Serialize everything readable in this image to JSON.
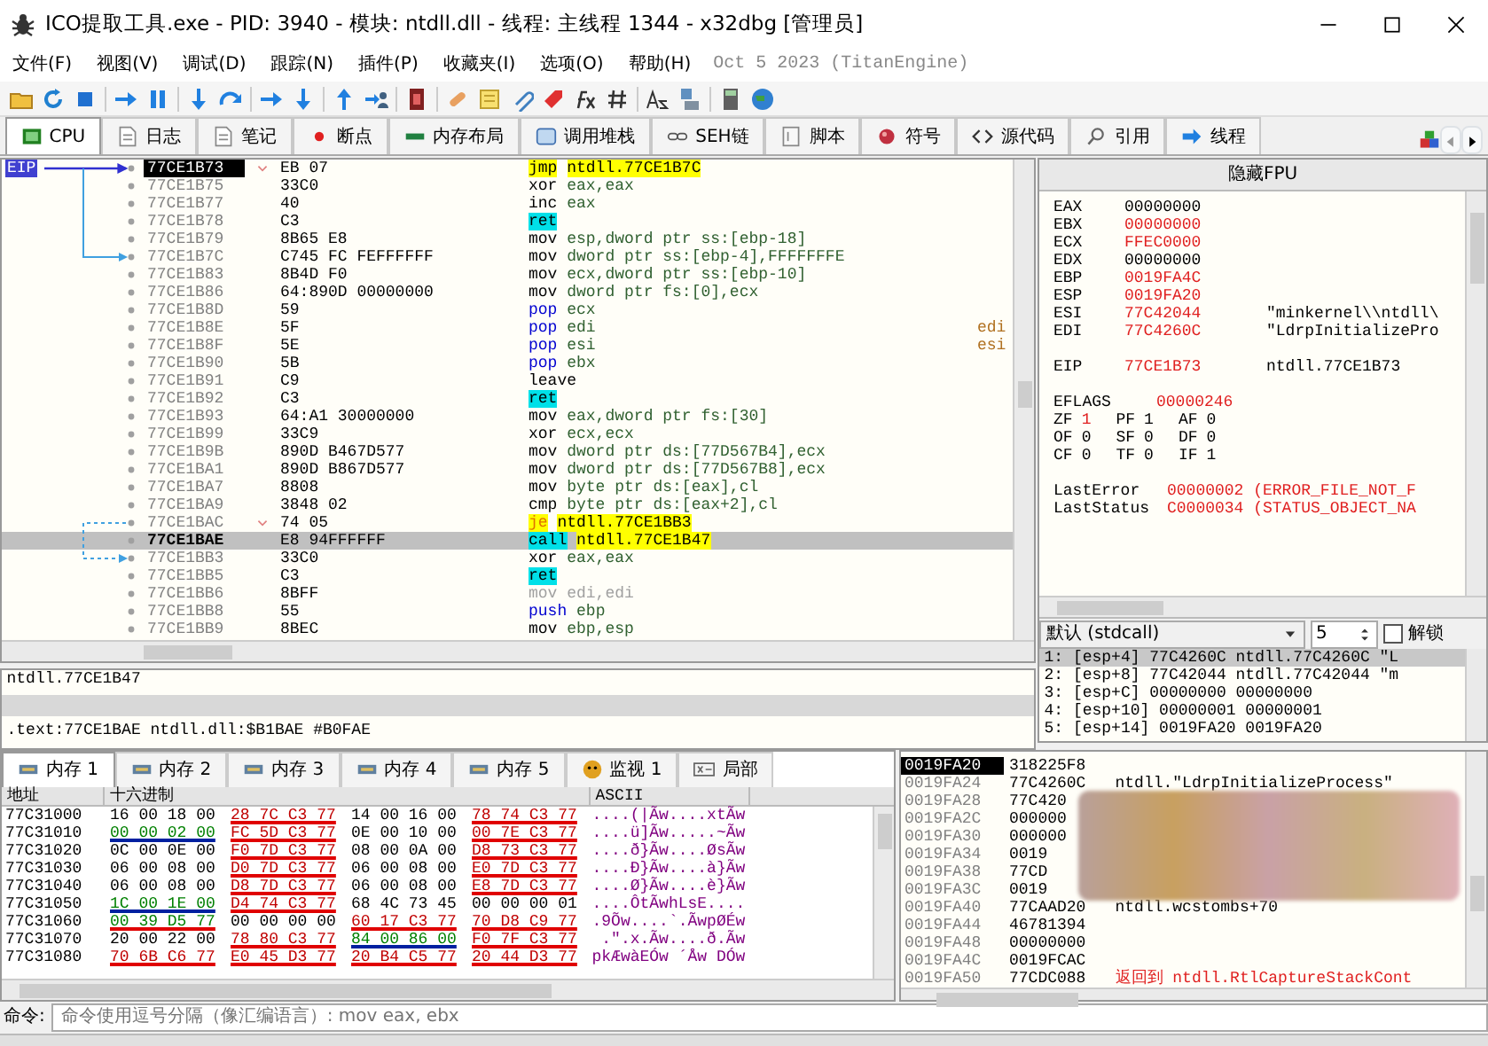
{
  "window": {
    "title": "ICO提取工具.exe - PID: 3940 - 模块: ntdll.dll - 线程: 主线程 1344 - x32dbg [管理员]"
  },
  "menu": [
    "文件(F)",
    "视图(V)",
    "调试(D)",
    "跟踪(N)",
    "插件(P)",
    "收藏夹(I)",
    "选项(O)",
    "帮助(H)"
  ],
  "build_info": "Oct 5 2023 (TitanEngine)",
  "tabs": [
    {
      "label": "CPU",
      "selected": true
    },
    {
      "label": "日志",
      "selected": false
    },
    {
      "label": "笔记",
      "selected": false
    },
    {
      "label": "断点",
      "selected": false
    },
    {
      "label": "内存布局",
      "selected": false
    },
    {
      "label": "调用堆栈",
      "selected": false
    },
    {
      "label": "SEH链",
      "selected": false
    },
    {
      "label": "脚本",
      "selected": false
    },
    {
      "label": "符号",
      "selected": false
    },
    {
      "label": "源代码",
      "selected": false
    },
    {
      "label": "引用",
      "selected": false
    },
    {
      "label": "线程",
      "selected": false
    }
  ],
  "disasm": {
    "eip_label": "EIP",
    "rows": [
      {
        "address": "77CE1B73",
        "bytes": "EB 07",
        "mnemonic": "jmp",
        "operands": "ntdll.77CE1B7C",
        "kind": "jump",
        "eip": true,
        "selected": false,
        "branch": true,
        "branch_taken": true
      },
      {
        "address": "77CE1B75",
        "bytes": "33C0",
        "mnemonic": "xor",
        "operands": "eax,eax",
        "kind": "plain",
        "eip": false,
        "selected": false
      },
      {
        "address": "77CE1B77",
        "bytes": "40",
        "mnemonic": "inc",
        "operands": "eax",
        "kind": "plain",
        "eip": false,
        "selected": false
      },
      {
        "address": "77CE1B78",
        "bytes": "C3",
        "mnemonic": "ret",
        "kind": "ret",
        "eip": false,
        "selected": false
      },
      {
        "address": "77CE1B79",
        "bytes": "8B65 E8",
        "mnemonic": "mov",
        "operands": "esp,dword ptr ss:[ebp-18]",
        "kind": "plain",
        "eip": false,
        "selected": false
      },
      {
        "address": "77CE1B7C",
        "bytes": "C745 FC FEFFFFFF",
        "mnemonic": "mov",
        "operands": "dword ptr ss:[ebp-4],FFFFFFFE",
        "kind": "plain",
        "eip": false,
        "selected": false,
        "arrow_target": true
      },
      {
        "address": "77CE1B83",
        "bytes": "8B4D F0",
        "mnemonic": "mov",
        "operands": "ecx,dword ptr ss:[ebp-10]",
        "kind": "plain",
        "eip": false,
        "selected": false
      },
      {
        "address": "77CE1B86",
        "bytes": "64:890D 00000000",
        "mnemonic": "mov",
        "operands": "dword ptr fs:[0],ecx",
        "kind": "plain",
        "eip": false,
        "selected": false
      },
      {
        "address": "77CE1B8D",
        "bytes": "59",
        "mnemonic": "pop",
        "operands": "ecx",
        "kind": "stack",
        "eip": false,
        "selected": false
      },
      {
        "address": "77CE1B8E",
        "bytes": "5F",
        "mnemonic": "pop",
        "operands": "edi",
        "kind": "stack",
        "eip": false,
        "selected": false,
        "comment": "edi"
      },
      {
        "address": "77CE1B8F",
        "bytes": "5E",
        "mnemonic": "pop",
        "operands": "esi",
        "kind": "stack",
        "eip": false,
        "selected": false,
        "comment": "esi"
      },
      {
        "address": "77CE1B90",
        "bytes": "5B",
        "mnemonic": "pop",
        "operands": "ebx",
        "kind": "stack",
        "eip": false,
        "selected": false
      },
      {
        "address": "77CE1B91",
        "bytes": "C9",
        "mnemonic": "leave",
        "kind": "plain",
        "eip": false,
        "selected": false
      },
      {
        "address": "77CE1B92",
        "bytes": "C3",
        "mnemonic": "ret",
        "kind": "ret",
        "eip": false,
        "selected": false
      },
      {
        "address": "77CE1B93",
        "bytes": "64:A1 30000000",
        "mnemonic": "mov",
        "operands": "eax,dword ptr fs:[30]",
        "kind": "plain",
        "eip": false,
        "selected": false
      },
      {
        "address": "77CE1B99",
        "bytes": "33C9",
        "mnemonic": "xor",
        "operands": "ecx,ecx",
        "kind": "plain",
        "eip": false,
        "selected": false
      },
      {
        "address": "77CE1B9B",
        "bytes": "890D B467D577",
        "mnemonic": "mov",
        "operands": "dword ptr ds:[77D567B4],ecx",
        "kind": "plain",
        "eip": false,
        "selected": false
      },
      {
        "address": "77CE1BA1",
        "bytes": "890D B867D577",
        "mnemonic": "mov",
        "operands": "dword ptr ds:[77D567B8],ecx",
        "kind": "plain",
        "eip": false,
        "selected": false
      },
      {
        "address": "77CE1BA7",
        "bytes": "8808",
        "mnemonic": "mov",
        "operands": "byte ptr ds:[eax],cl",
        "kind": "plain",
        "eip": false,
        "selected": false
      },
      {
        "address": "77CE1BA9",
        "bytes": "3848 02",
        "mnemonic": "cmp",
        "operands": "byte ptr ds:[eax+2],cl",
        "kind": "plain",
        "eip": false,
        "selected": false
      },
      {
        "address": "77CE1BAC",
        "bytes": "74 05",
        "mnemonic": "je",
        "operands": "ntdll.77CE1BB3",
        "kind": "cond-jump",
        "eip": false,
        "selected": false,
        "branch": true,
        "branch_taken": false
      },
      {
        "address": "77CE1BAE",
        "bytes": "E8 94FFFFFF",
        "mnemonic": "call",
        "operands": "ntdll.77CE1B47",
        "kind": "call",
        "eip": false,
        "selected": true
      },
      {
        "address": "77CE1BB3",
        "bytes": "33C0",
        "mnemonic": "xor",
        "operands": "eax,eax",
        "kind": "plain",
        "eip": false,
        "selected": false,
        "arrow_target": true
      },
      {
        "address": "77CE1BB5",
        "bytes": "C3",
        "mnemonic": "ret",
        "kind": "ret",
        "eip": false,
        "selected": false
      },
      {
        "address": "77CE1BB6",
        "bytes": "8BFF",
        "mnemonic": "mov",
        "operands": "edi,edi",
        "kind": "padding",
        "eip": false,
        "selected": false
      },
      {
        "address": "77CE1BB8",
        "bytes": "55",
        "mnemonic": "push",
        "operands": "ebp",
        "kind": "stack",
        "eip": false,
        "selected": false
      },
      {
        "address": "77CE1BB9",
        "bytes": "8BEC",
        "mnemonic": "mov",
        "operands": "ebp,esp",
        "kind": "plain",
        "eip": false,
        "selected": false
      }
    ]
  },
  "registers": {
    "header": "隐藏FPU",
    "general": [
      {
        "name": "EAX",
        "value": "00000000",
        "changed": false
      },
      {
        "name": "EBX",
        "value": "00000000",
        "changed": true
      },
      {
        "name": "ECX",
        "value": "FFEC0000",
        "changed": true
      },
      {
        "name": "EDX",
        "value": "00000000",
        "changed": false
      },
      {
        "name": "EBP",
        "value": "0019FA4C",
        "changed": true
      },
      {
        "name": "ESP",
        "value": "0019FA20",
        "changed": true
      },
      {
        "name": "ESI",
        "value": "77C42044",
        "changed": true,
        "comment": "\"minkernel\\\\ntdll\\"
      },
      {
        "name": "EDI",
        "value": "77C4260C",
        "changed": true,
        "comment": "\"LdrpInitializePro"
      }
    ],
    "eip": {
      "name": "EIP",
      "value": "77CE1B73",
      "changed": true,
      "comment": "ntdll.77CE1B73"
    },
    "eflags": {
      "name": "EFLAGS",
      "value": "00000246",
      "changed": true
    },
    "flags": [
      [
        {
          "name": "ZF",
          "value": "1",
          "changed": true
        },
        {
          "name": "PF",
          "value": "1",
          "changed": false
        },
        {
          "name": "AF",
          "value": "0",
          "changed": false
        }
      ],
      [
        {
          "name": "OF",
          "value": "0",
          "changed": false
        },
        {
          "name": "SF",
          "value": "0",
          "changed": false
        },
        {
          "name": "DF",
          "value": "0",
          "changed": false
        }
      ],
      [
        {
          "name": "CF",
          "value": "0",
          "changed": false
        },
        {
          "name": "TF",
          "value": "0",
          "changed": false
        },
        {
          "name": "IF",
          "value": "1",
          "changed": false
        }
      ]
    ],
    "errors": [
      {
        "name": "LastError",
        "value": "00000002 (ERROR_FILE_NOT_F"
      },
      {
        "name": "LastStatus",
        "value": "C0000034 (STATUS_OBJECT_NA"
      }
    ]
  },
  "call_convention": {
    "value": "默认 (stdcall)",
    "count": "5",
    "unlock_label": "解锁",
    "unlock_checked": false
  },
  "arguments": [
    {
      "text": "1: [esp+4] 77C4260C ntdll.77C4260C \"L",
      "selected": true
    },
    {
      "text": "2: [esp+8] 77C42044 ntdll.77C42044 \"m",
      "selected": false
    },
    {
      "text": "3: [esp+C] 00000000 00000000",
      "selected": false
    },
    {
      "text": "4: [esp+10] 00000001 00000001",
      "selected": false
    },
    {
      "text": "5: [esp+14] 0019FA20 0019FA20",
      "selected": false
    }
  ],
  "info": {
    "line_1": "ntdll.77CE1B47",
    "line_2": ".text:77CE1BAE ntdll.dll:$B1BAE #B0FAE"
  },
  "dump": {
    "tabs": [
      {
        "label": "内存 1",
        "kind": "memory",
        "selected": true
      },
      {
        "label": "内存 2",
        "kind": "memory",
        "selected": false
      },
      {
        "label": "内存 3",
        "kind": "memory",
        "selected": false
      },
      {
        "label": "内存 4",
        "kind": "memory",
        "selected": false
      },
      {
        "label": "内存 5",
        "kind": "memory",
        "selected": false
      },
      {
        "label": "监视 1",
        "kind": "watch",
        "selected": false
      },
      {
        "label": "局部",
        "kind": "locals",
        "selected": false
      }
    ],
    "columns": [
      "地址",
      "十六进制",
      "ASCII"
    ],
    "rows": [
      {
        "address": "77C31000",
        "groups": [
          {
            "hex": "16 00 18 00",
            "kind": "plain"
          },
          {
            "hex": "28 7C C3 77",
            "kind": "pointer"
          },
          {
            "hex": "14 00 16 00",
            "kind": "plain"
          },
          {
            "hex": "78 74 C3 77",
            "kind": "pointer"
          }
        ],
        "ascii": "....(|Ãw....xtÃw"
      },
      {
        "address": "77C31010",
        "groups": [
          {
            "hex": "00 00 02 00",
            "kind": "word"
          },
          {
            "hex": "FC 5D C3 77",
            "kind": "pointer"
          },
          {
            "hex": "0E 00 10 00",
            "kind": "plain"
          },
          {
            "hex": "00 7E C3 77",
            "kind": "pointer"
          }
        ],
        "ascii": "....ü]Ãw.....~Ãw"
      },
      {
        "address": "77C31020",
        "groups": [
          {
            "hex": "0C 00 0E 00",
            "kind": "plain"
          },
          {
            "hex": "F0 7D C3 77",
            "kind": "pointer"
          },
          {
            "hex": "08 00 0A 00",
            "kind": "plain"
          },
          {
            "hex": "D8 73 C3 77",
            "kind": "pointer"
          }
        ],
        "ascii": "....ð}Ãw....ØsÃw"
      },
      {
        "address": "77C31030",
        "groups": [
          {
            "hex": "06 00 08 00",
            "kind": "plain"
          },
          {
            "hex": "D0 7D C3 77",
            "kind": "pointer"
          },
          {
            "hex": "06 00 08 00",
            "kind": "plain"
          },
          {
            "hex": "E0 7D C3 77",
            "kind": "pointer"
          }
        ],
        "ascii": "....Ð}Ãw....à}Ãw"
      },
      {
        "address": "77C31040",
        "groups": [
          {
            "hex": "06 00 08 00",
            "kind": "plain"
          },
          {
            "hex": "D8 7D C3 77",
            "kind": "pointer"
          },
          {
            "hex": "06 00 08 00",
            "kind": "plain"
          },
          {
            "hex": "E8 7D C3 77",
            "kind": "pointer"
          }
        ],
        "ascii": "....Ø}Ãw....è}Ãw"
      },
      {
        "address": "77C31050",
        "groups": [
          {
            "hex": "1C 00 1E 00",
            "kind": "word"
          },
          {
            "hex": "D4 74 C3 77",
            "kind": "pointer"
          },
          {
            "hex": "68 4C 73 45",
            "kind": "plain"
          },
          {
            "hex": "00 00 00 01",
            "kind": "plain"
          }
        ],
        "ascii": "....ÔtÃwhLsE...."
      },
      {
        "address": "77C31060",
        "groups": [
          {
            "hex": "00 39 D5 77",
            "kind": "code"
          },
          {
            "hex": "00 00 00 00",
            "kind": "plain"
          },
          {
            "hex": "60 17 C3 77",
            "kind": "pointer"
          },
          {
            "hex": "70 D8 C9 77",
            "kind": "pointer"
          }
        ],
        "ascii": ".9Õw....`.ÃwpØÉw"
      },
      {
        "address": "77C31070",
        "groups": [
          {
            "hex": "20 00 22 00",
            "kind": "plain"
          },
          {
            "hex": "78 80 C3 77",
            "kind": "pointer"
          },
          {
            "hex": "84 00 86 00",
            "kind": "word"
          },
          {
            "hex": "F0 7F C3 77",
            "kind": "pointer"
          }
        ],
        "ascii": " .\".x.Ãw....ð.Ãw"
      },
      {
        "address": "77C31080",
        "groups": [
          {
            "hex": "70 6B C6 77",
            "kind": "pointer"
          },
          {
            "hex": "E0 45 D3 77",
            "kind": "pointer"
          },
          {
            "hex": "20 B4 C5 77",
            "kind": "pointer"
          },
          {
            "hex": "20 44 D3 77",
            "kind": "pointer"
          }
        ],
        "ascii": "pkÆwàEÓw ´Åw DÓw"
      }
    ]
  },
  "stack": {
    "rows": [
      {
        "address": "0019FA20",
        "value": "318225F8",
        "selected": true
      },
      {
        "address": "0019FA24",
        "value": "77C4260C",
        "comment": "ntdll.\"LdrpInitializeProcess\"",
        "selected": false
      },
      {
        "address": "0019FA28",
        "value": "77C420",
        "selected": false
      },
      {
        "address": "0019FA2C",
        "value": "000000",
        "selected": false
      },
      {
        "address": "0019FA30",
        "value": "000000",
        "selected": false
      },
      {
        "address": "0019FA34",
        "value": "0019",
        "selected": false
      },
      {
        "address": "0019FA38",
        "value": "77CD",
        "selected": false
      },
      {
        "address": "0019FA3C",
        "value": "0019",
        "selected": false
      },
      {
        "address": "0019FA40",
        "value": "77CAAD20",
        "comment": "ntdll.wcstombs+70",
        "selected": false
      },
      {
        "address": "0019FA44",
        "value": "46781394",
        "selected": false
      },
      {
        "address": "0019FA48",
        "value": "00000000",
        "selected": false
      },
      {
        "address": "0019FA4C",
        "value": "0019FCAC",
        "selected": false
      },
      {
        "address": "0019FA50",
        "value": "77CDC088",
        "comment": "返回到 ntdll.RtlCaptureStackCont",
        "kind": "return",
        "selected": false
      }
    ]
  },
  "command": {
    "label": "命令:",
    "placeholder": "命令使用逗号分隔（像汇编语言）: mov eax, ebx"
  }
}
